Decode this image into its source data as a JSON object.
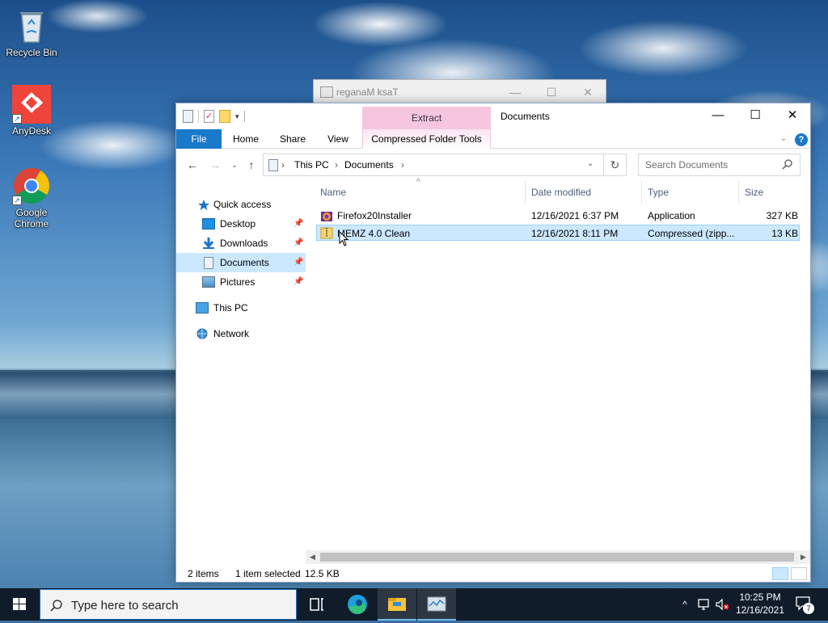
{
  "desktop": {
    "icons": [
      {
        "label": "Recycle Bin",
        "icon": "recycle-bin-icon"
      },
      {
        "label": "AnyDesk",
        "icon": "anydesk-icon"
      },
      {
        "label": "Google Chrome",
        "icon": "chrome-icon"
      }
    ]
  },
  "background_window": {
    "title": "reganaM ksaT",
    "icon": "task-manager-icon"
  },
  "explorer": {
    "title": "Documents",
    "contextual_tab": "Extract",
    "ribbon_tabs": [
      "File",
      "Home",
      "Share",
      "View",
      "Compressed Folder Tools"
    ],
    "breadcrumb": [
      "This PC",
      "Documents"
    ],
    "search_placeholder": "Search Documents",
    "nav": {
      "quick_access": "Quick access",
      "items": [
        {
          "label": "Desktop",
          "pinned": true
        },
        {
          "label": "Downloads",
          "pinned": true
        },
        {
          "label": "Documents",
          "pinned": true,
          "selected": true
        },
        {
          "label": "Pictures",
          "pinned": true
        }
      ],
      "this_pc": "This PC",
      "network": "Network"
    },
    "columns": [
      "Name",
      "Date modified",
      "Type",
      "Size"
    ],
    "files": [
      {
        "name": "Firefox20Installer",
        "date": "12/16/2021 6:37 PM",
        "type": "Application",
        "size": "327 KB",
        "icon": "firefox-installer-icon",
        "selected": false
      },
      {
        "name": "MEMZ 4.0 Clean",
        "date": "12/16/2021 8:11 PM",
        "type": "Compressed (zipp...",
        "size": "13 KB",
        "icon": "zip-folder-icon",
        "selected": true
      }
    ],
    "status": {
      "items": "2 items",
      "selected": "1 item selected",
      "size": "12.5 KB"
    }
  },
  "taskbar": {
    "search_placeholder": "Type here to search",
    "time": "10:25 PM",
    "date": "12/16/2021",
    "notifications": "7"
  },
  "colors": {
    "accent": "#1979ca",
    "selection": "#cce8ff",
    "extract_tab": "#f6c6e0",
    "taskbar": "#101c2a"
  }
}
